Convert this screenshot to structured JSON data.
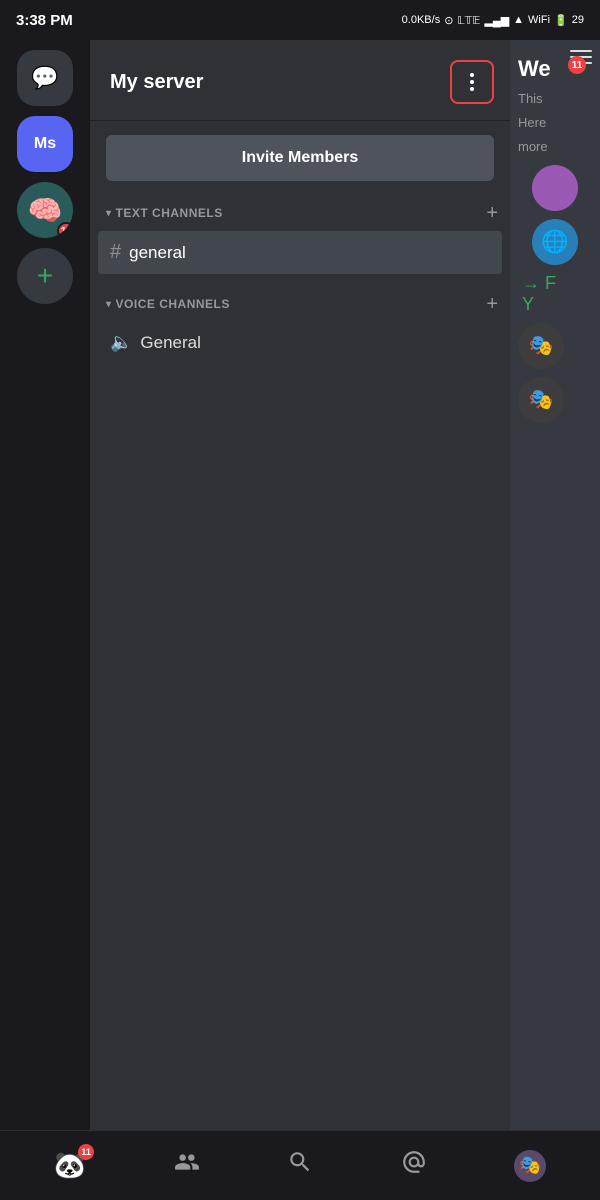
{
  "statusBar": {
    "time": "3:38 PM",
    "network": "0.0KB/s",
    "battery": "29"
  },
  "leftSidebar": {
    "chatIconLabel": "💬",
    "serverAbbr": "Ms",
    "badgeCount": "11",
    "addLabel": "+"
  },
  "channelPanel": {
    "serverName": "My server",
    "inviteBtn": "Invite Members",
    "textChannelsLabel": "TEXT CHANNELS",
    "voiceChannelsLabel": "VOICE CHANNELS",
    "textChannels": [
      {
        "name": "general",
        "icon": "#",
        "active": true
      }
    ],
    "voiceChannels": [
      {
        "name": "General",
        "active": false
      }
    ]
  },
  "rightPeek": {
    "title": "We",
    "lines": [
      "This",
      "Here",
      "more"
    ],
    "arrowText": "→ F",
    "arrowSub": "Y",
    "menuBadge": "11"
  },
  "bottomBar": {
    "tabs": [
      {
        "name": "home",
        "icon": "🐼",
        "badge": "11",
        "active": false
      },
      {
        "name": "friends",
        "icon": "👤",
        "badge": null,
        "active": false
      },
      {
        "name": "search",
        "icon": "🔍",
        "badge": null,
        "active": false
      },
      {
        "name": "mentions",
        "icon": "📡",
        "badge": null,
        "active": false
      },
      {
        "name": "profile",
        "icon": "👤",
        "badge": null,
        "active": false
      }
    ]
  }
}
